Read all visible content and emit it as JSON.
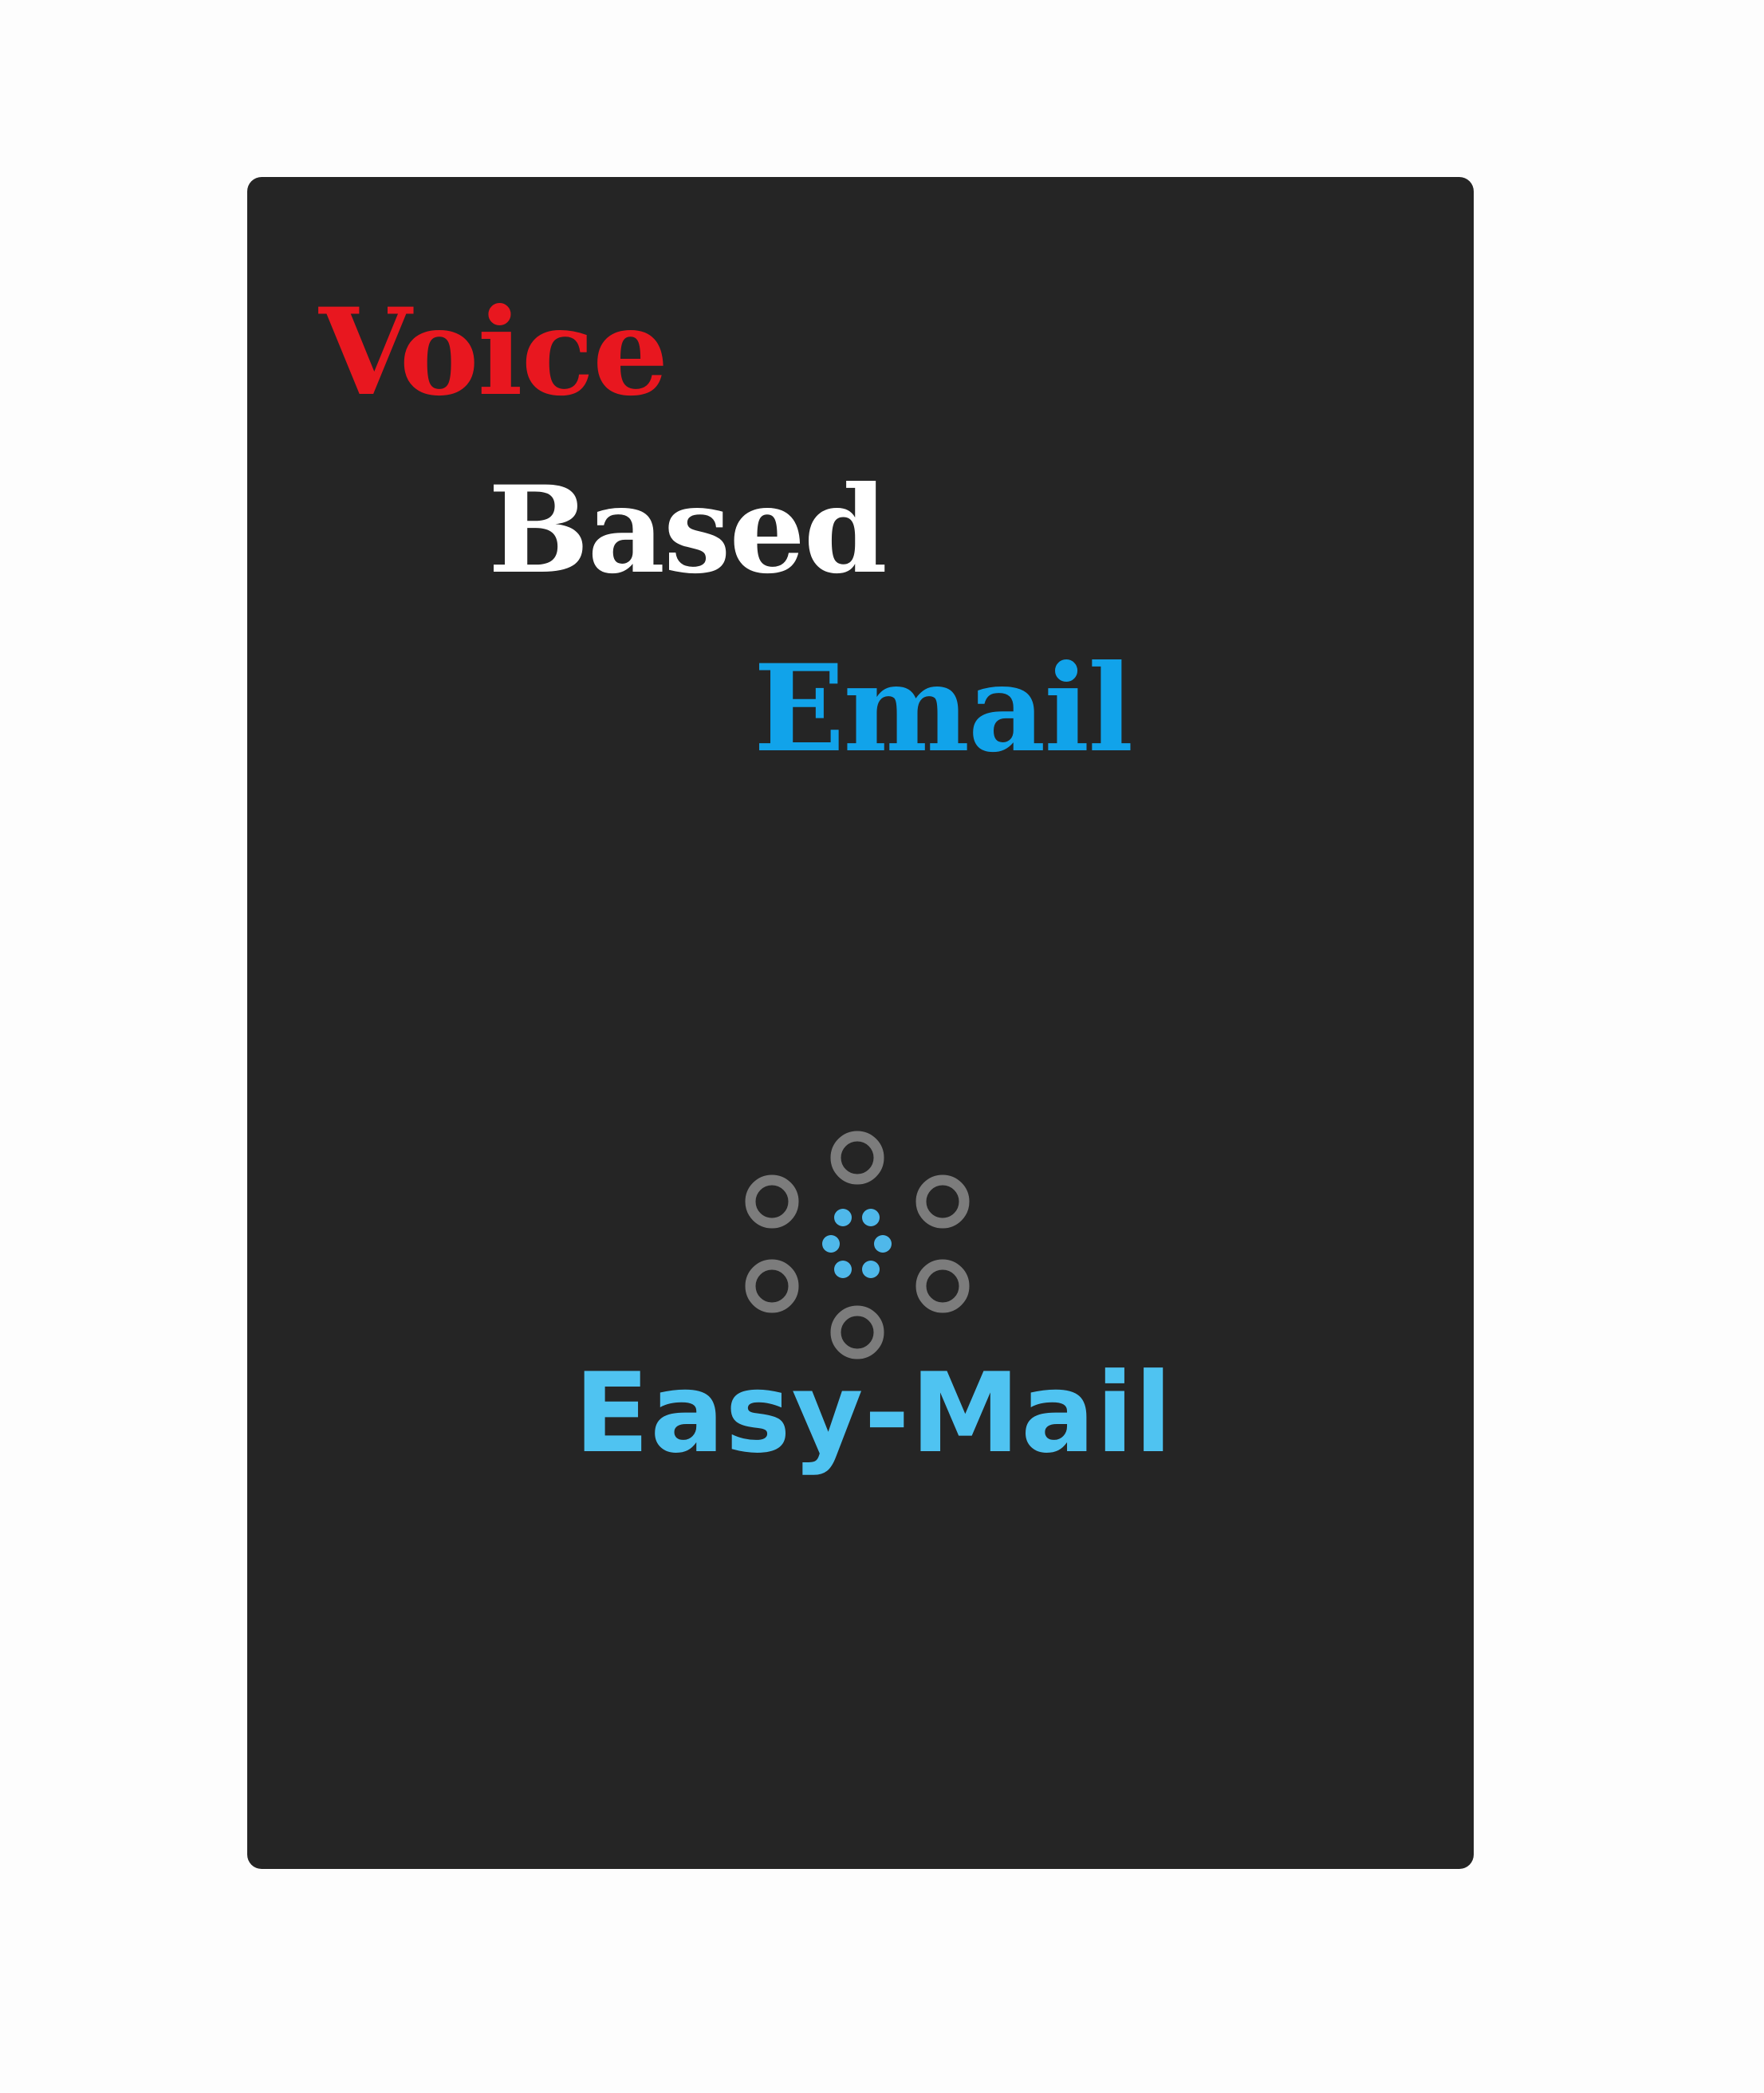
{
  "headline": {
    "line1": "Voice",
    "line2": "Based",
    "line3": "Email"
  },
  "logo": {
    "icon": "easy-mail-logo-icon",
    "name": "Easy-Mail"
  },
  "colors": {
    "page_background": "#fdfdfd",
    "card_background": "#252525",
    "voice": "#e8171f",
    "based": "#ffffff",
    "email": "#11a3ea",
    "logo_text": "#4fc3f1",
    "logo_rings": "#7c7c7c",
    "logo_dots": "#4fb8ea"
  }
}
